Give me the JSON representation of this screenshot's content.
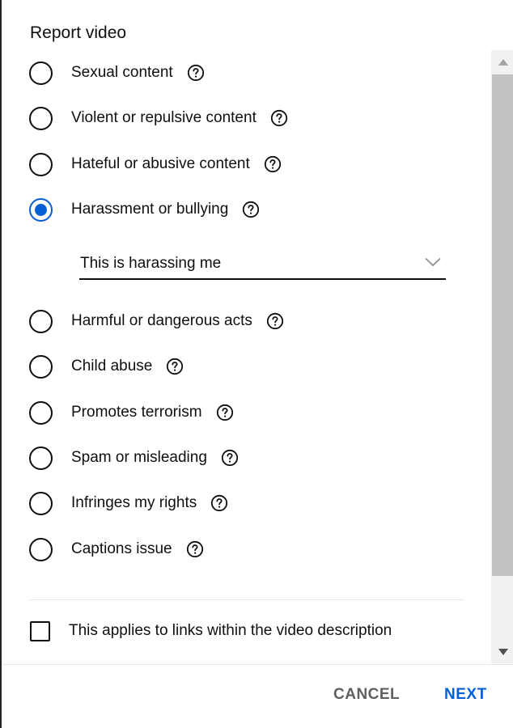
{
  "dialog": {
    "title": "Report video",
    "options": [
      {
        "label": "Sexual content",
        "selected": false
      },
      {
        "label": "Violent or repulsive content",
        "selected": false
      },
      {
        "label": "Hateful or abusive content",
        "selected": false
      },
      {
        "label": "Harassment or bullying",
        "selected": true
      },
      {
        "label": "Harmful or dangerous acts",
        "selected": false
      },
      {
        "label": "Child abuse",
        "selected": false
      },
      {
        "label": "Promotes terrorism",
        "selected": false
      },
      {
        "label": "Spam or misleading",
        "selected": false
      },
      {
        "label": "Infringes my rights",
        "selected": false
      },
      {
        "label": "Captions issue",
        "selected": false
      }
    ],
    "sub_reason": {
      "value": "This is harassing me"
    },
    "links_checkbox": {
      "label": "This applies to links within the video description",
      "checked": false
    },
    "cancel_label": "CANCEL",
    "next_label": "NEXT",
    "icons": {
      "help": "help-circle-icon",
      "dropdown": "chevron-down-icon"
    },
    "colors": {
      "accent": "#065fd4",
      "text": "#0f0f0f",
      "muted": "#606060"
    }
  }
}
